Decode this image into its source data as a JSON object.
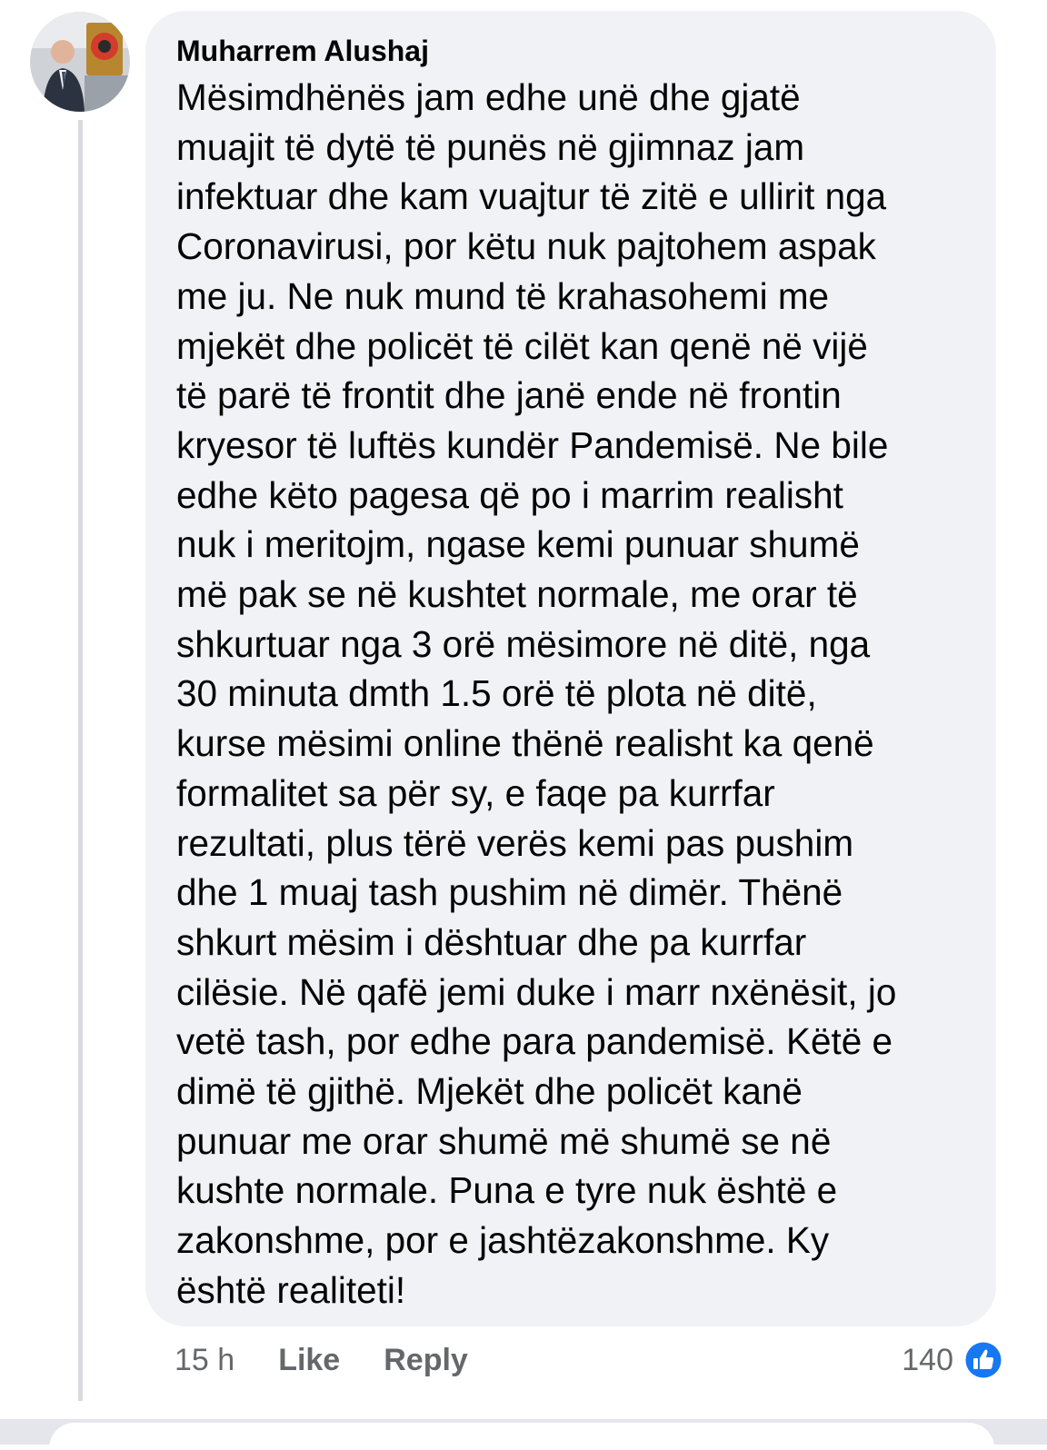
{
  "comment": {
    "author": "Muharrem Alushaj",
    "avatar_icon": "profile-photo-icon",
    "lines": [
      "Mësimdhënës jam edhe unë dhe gjatë",
      "muajit të dytë të punës në gjimnaz jam",
      "infektuar dhe kam vuajtur të zitë e ullirit nga",
      "Coronavirusi, por këtu nuk pajtohem aspak",
      "me ju. Ne nuk mund të krahasohemi me",
      "mjekët dhe policët të cilët kan qenë në vijë",
      "të parë të frontit dhe janë ende në frontin",
      "kryesor të luftës kundër Pandemisë. Ne bile",
      "edhe këto pagesa që po i marrim realisht",
      "nuk i meritojm, ngase kemi punuar shumë",
      "më pak se në kushtet normale, me orar të",
      "shkurtuar nga 3 orë mësimore në ditë, nga",
      "30 minuta dmth 1.5 orë të plota në ditë,",
      "kurse mësimi online thënë realisht ka qenë",
      "formalitet sa për sy, e faqe pa kurrfar",
      "rezultati, plus tërë verës kemi pas pushim",
      "dhe 1 muaj tash pushim në dimër. Thënë",
      "shkurt mësim i dështuar dhe pa kurrfar",
      "cilësie. Në qafë jemi duke i marr nxënësit, jo",
      "vetë tash, por edhe para pandemisë. Këtë e",
      "dimë të gjithë. Mjekët dhe policët kanë",
      "punuar me orar shumë më shumë se në",
      "kushte normale. Puna e tyre nuk është e",
      "zakonshme, por e jashtëzakonshme. Ky",
      "është realiteti!"
    ]
  },
  "actions": {
    "time": "15 h",
    "like_label": "Like",
    "reply_label": "Reply"
  },
  "reactions": {
    "count": "140",
    "icon": "thumbs-up-icon",
    "color": "#1877f2"
  }
}
